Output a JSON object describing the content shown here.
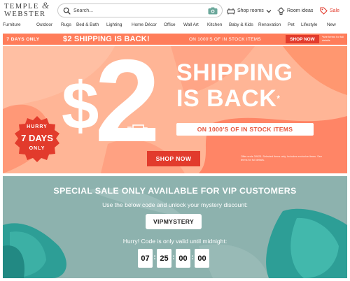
{
  "header": {
    "logo_line1": "TEMPLE",
    "logo_amp": "&",
    "logo_line2": "WEBSTER",
    "search_placeholder": "Search...",
    "shop_rooms": "Shop rooms",
    "room_ideas": "Room ideas",
    "sale": "Sale"
  },
  "nav": {
    "items": [
      "Furniture",
      "Outdoor",
      "Rugs",
      "Bed & Bath",
      "Lighting",
      "Home Décor",
      "Office",
      "Wall Art",
      "Kitchen",
      "Baby & Kids",
      "Renovation",
      "Pet",
      "Lifestyle",
      "New"
    ]
  },
  "promo_strip": {
    "days": "7 DAYS ONLY",
    "headline": "$2 SHIPPING IS BACK!",
    "sub": "ON 1000'S OF IN STOCK ITEMS",
    "button": "SHOP NOW",
    "terms": "*see terms for full details"
  },
  "hero": {
    "price_currency": "$",
    "price_value": "2",
    "headline_line1": "SHIPPING",
    "headline_line2": "IS BACK",
    "headline_mark": "*",
    "pill": "ON 1000'S OF IN STOCK ITEMS",
    "badge_top": "HURRY",
    "badge_mid": "7 DAYS",
    "badge_bot": "ONLY",
    "button": "SHOP NOW",
    "fine_print": "Offer ends 3/9/23. Selected items only. Includes exclusive items. See terms for full details."
  },
  "vip": {
    "title": "SPECIAL SALE ONLY AVAILABLE FOR VIP CUSTOMERS",
    "subtitle": "Use the below code and unlock your mystery discount:",
    "code": "VIPMYSTERY",
    "hurry": "Hurry! Code is only valid until midnight:",
    "timer": [
      "07",
      "25",
      "00",
      "00"
    ]
  },
  "colors": {
    "accent_red": "#e23b2c",
    "strip_orange": "#ff7d5a",
    "teal": "#8fb3b0"
  }
}
